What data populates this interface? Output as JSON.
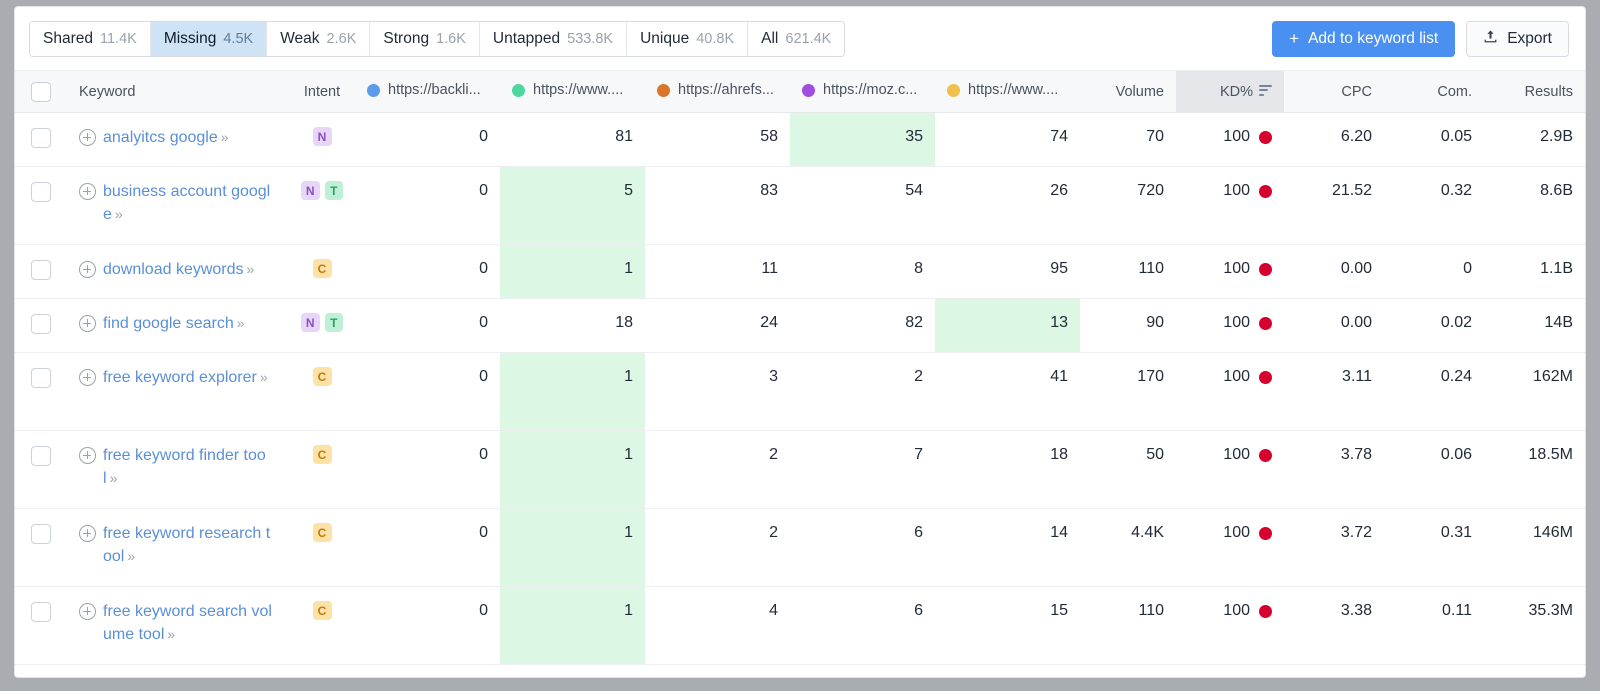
{
  "toolbar": {
    "segments": [
      {
        "label": "Shared",
        "count": "11.4K",
        "active": false
      },
      {
        "label": "Missing",
        "count": "4.5K",
        "active": true
      },
      {
        "label": "Weak",
        "count": "2.6K",
        "active": false
      },
      {
        "label": "Strong",
        "count": "1.6K",
        "active": false
      },
      {
        "label": "Untapped",
        "count": "533.8K",
        "active": false
      },
      {
        "label": "Unique",
        "count": "40.8K",
        "active": false
      },
      {
        "label": "All",
        "count": "621.4K",
        "active": false
      }
    ],
    "add_to_list_label": "Add to keyword list",
    "add_to_list_icon": "plus-icon",
    "export_label": "Export",
    "export_icon": "upload-icon",
    "primary_color": "#4a90f0"
  },
  "table": {
    "headers": {
      "select_all": "select-all-checkbox",
      "keyword": "Keyword",
      "intent": "Intent",
      "volume": "Volume",
      "kd": "KD%",
      "kd_sort_icon": "sort-descending-icon",
      "cpc": "CPC",
      "com": "Com.",
      "results": "Results"
    },
    "url_columns": [
      {
        "label": "https://backli...",
        "color": "#5b9bea"
      },
      {
        "label": "https://www....",
        "color": "#4dd6a0"
      },
      {
        "label": "https://ahrefs...",
        "color": "#d9762a"
      },
      {
        "label": "https://moz.c...",
        "color": "#a04ee0"
      },
      {
        "label": "https://www....",
        "color": "#f0c04a"
      }
    ],
    "kd_dot_color": "#d6002e",
    "highlight_color": "#dcf7e3",
    "rows": [
      {
        "keyword": "analyitcs google",
        "intents": [
          "N"
        ],
        "urls": [
          "0",
          "81",
          "58",
          "35",
          "74"
        ],
        "highlight": 3,
        "volume": "70",
        "kd": "100",
        "cpc": "6.20",
        "com": "0.05",
        "results": "2.9B",
        "tall": false
      },
      {
        "keyword": "business account google",
        "intents": [
          "N",
          "T"
        ],
        "urls": [
          "0",
          "5",
          "83",
          "54",
          "26"
        ],
        "highlight": 1,
        "volume": "720",
        "kd": "100",
        "cpc": "21.52",
        "com": "0.32",
        "results": "8.6B",
        "tall": true
      },
      {
        "keyword": "download keywords",
        "intents": [
          "C"
        ],
        "urls": [
          "0",
          "1",
          "11",
          "8",
          "95"
        ],
        "highlight": 1,
        "volume": "110",
        "kd": "100",
        "cpc": "0.00",
        "com": "0",
        "results": "1.1B",
        "tall": false
      },
      {
        "keyword": "find google search",
        "intents": [
          "N",
          "T"
        ],
        "urls": [
          "0",
          "18",
          "24",
          "82",
          "13"
        ],
        "highlight": 4,
        "volume": "90",
        "kd": "100",
        "cpc": "0.00",
        "com": "0.02",
        "results": "14B",
        "tall": false
      },
      {
        "keyword": "free keyword explorer",
        "intents": [
          "C"
        ],
        "urls": [
          "0",
          "1",
          "3",
          "2",
          "41"
        ],
        "highlight": 1,
        "volume": "170",
        "kd": "100",
        "cpc": "3.11",
        "com": "0.24",
        "results": "162M",
        "tall": true
      },
      {
        "keyword": "free keyword finder tool",
        "intents": [
          "C"
        ],
        "urls": [
          "0",
          "1",
          "2",
          "7",
          "18"
        ],
        "highlight": 1,
        "volume": "50",
        "kd": "100",
        "cpc": "3.78",
        "com": "0.06",
        "results": "18.5M",
        "tall": true
      },
      {
        "keyword": "free keyword research tool",
        "intents": [
          "C"
        ],
        "urls": [
          "0",
          "1",
          "2",
          "6",
          "14"
        ],
        "highlight": 1,
        "volume": "4.4K",
        "kd": "100",
        "cpc": "3.72",
        "com": "0.31",
        "results": "146M",
        "tall": true
      },
      {
        "keyword": "free keyword search volume tool",
        "intents": [
          "C"
        ],
        "urls": [
          "0",
          "1",
          "4",
          "6",
          "15"
        ],
        "highlight": 1,
        "volume": "110",
        "kd": "100",
        "cpc": "3.38",
        "com": "0.11",
        "results": "35.3M",
        "tall": true
      }
    ]
  }
}
